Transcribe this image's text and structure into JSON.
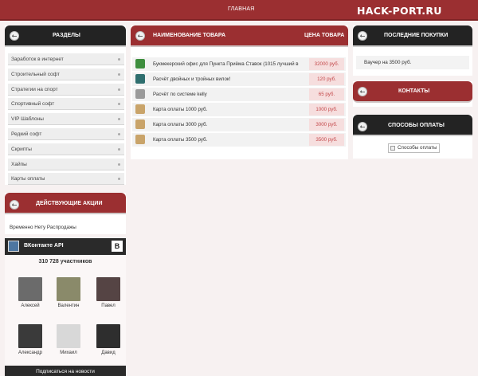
{
  "topbar": {
    "nav_home": "ГЛАВНАЯ",
    "logo": "HACK-PORT.RU"
  },
  "sections": {
    "title": "РАЗДЕЛЫ",
    "items": [
      "Заработок в интернет",
      "Строительный софт",
      "Стратегии на спорт",
      "Спортивный софт",
      "VIP Шаблоны",
      "Редкий софт",
      "Скрипты",
      "Хайпы",
      "Карты оплаты"
    ]
  },
  "promotions": {
    "title": "ДЕЙСТВУЮЩИЕ АКЦИИ",
    "text": "Временно Нету Распродажы"
  },
  "vk": {
    "title": "ВКонтакте API",
    "b_label": "B",
    "members_count": "310 728 участников",
    "members": [
      {
        "name": "Алексей",
        "color": "#6b6b6b"
      },
      {
        "name": "Валентин",
        "color": "#8a8a6a"
      },
      {
        "name": "Павел",
        "color": "#554444"
      },
      {
        "name": "Александр",
        "color": "#3a3a3a"
      },
      {
        "name": "Михаил",
        "color": "#d8d8d8"
      },
      {
        "name": "Давид",
        "color": "#2e2e2e"
      }
    ],
    "subscribe_label": "Подписаться на новости"
  },
  "products": {
    "name_header": "НАИМЕНОВАНИЕ ТОВАРА",
    "price_header": "ЦЕНА ТОВАРА",
    "rows": [
      {
        "name": "Букмекерский офис для Пункта Приёма Ставок (1015 лучший в",
        "price": "32000 руб.",
        "icon": "green-arrow-icon",
        "icon_color": "#3e8e3e"
      },
      {
        "name": "Расчёт двойных и тройных вилок!",
        "price": "120 руб.",
        "icon": "chart-icon",
        "icon_color": "#2f6f6f"
      },
      {
        "name": "Расчёт по системе kelly",
        "price": "65 руб.",
        "icon": "document-icon",
        "icon_color": "#9a9a9a"
      },
      {
        "name": "Карта оплаты 1000 руб.",
        "price": "1000 руб.",
        "icon": "card-icon",
        "icon_color": "#c9a46a"
      },
      {
        "name": "Карта оплаты 3000 руб.",
        "price": "3000 руб.",
        "icon": "card-icon",
        "icon_color": "#c9a46a"
      },
      {
        "name": "Карта оплаты 3500 руб.",
        "price": "3500 руб.",
        "icon": "card-icon",
        "icon_color": "#c9a46a"
      }
    ]
  },
  "recent": {
    "title": "ПОСЛЕДНИЕ ПОКУПКИ",
    "item": "Ваучер на 3500 руб."
  },
  "contacts": {
    "title": "КОНТАКТЫ"
  },
  "payments": {
    "title": "СПОСОБЫ ОПЛАТЫ",
    "image_alt": "Способы оплаты"
  }
}
